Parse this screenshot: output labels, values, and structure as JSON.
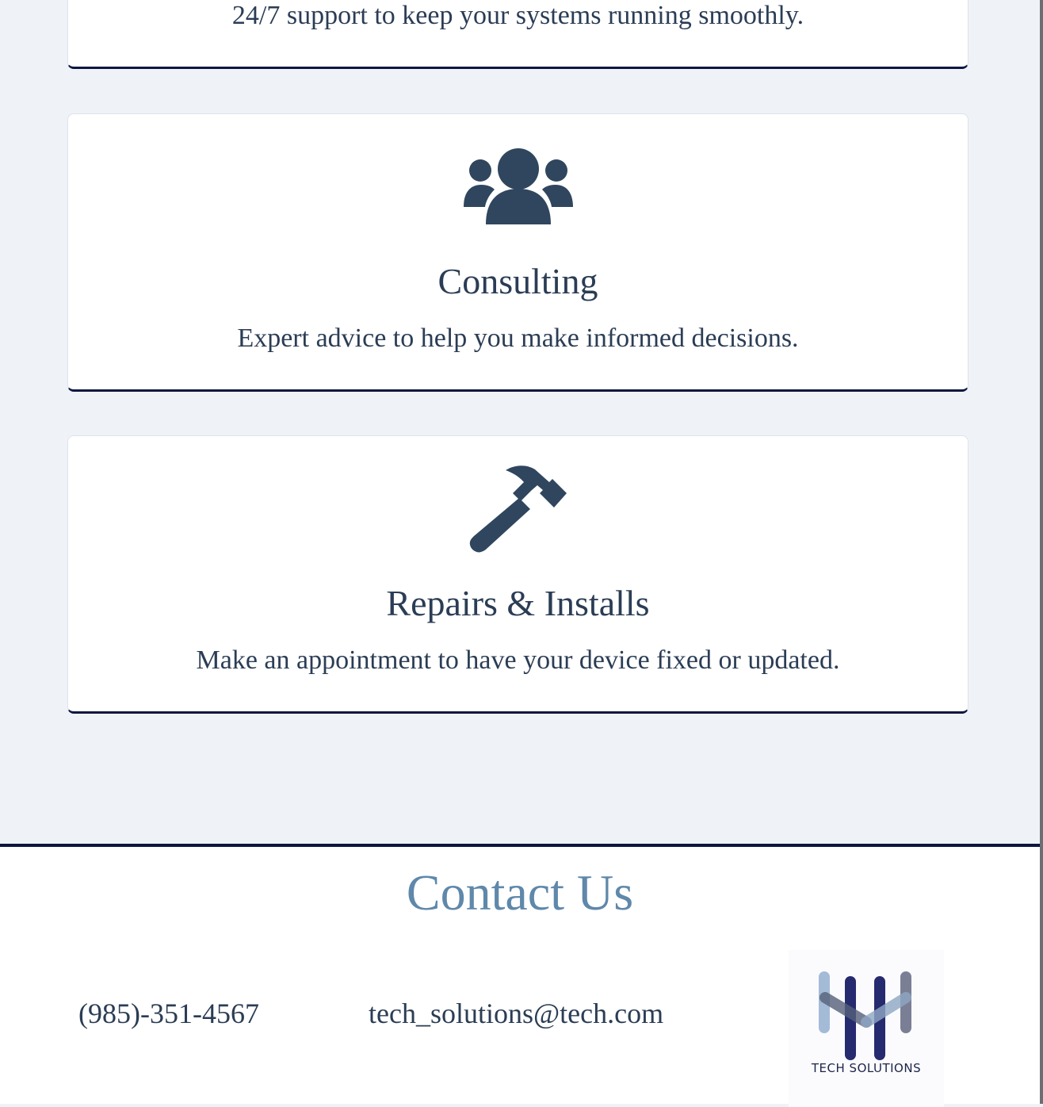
{
  "services": [
    {
      "title": "",
      "description": "24/7 support to keep your systems running smoothly."
    },
    {
      "icon": "users-icon",
      "title": "Consulting",
      "description": "Expert advice to help you make informed decisions."
    },
    {
      "icon": "hammer-icon",
      "title": "Repairs & Installs",
      "description": "Make an appointment to have your device fixed or updated."
    }
  ],
  "contact": {
    "title": "Contact Us",
    "phone": "(985)-351-4567",
    "email": "tech_solutions@tech.com",
    "logo_text": "TECH SOLUTIONS"
  },
  "colors": {
    "background": "#eff3f8",
    "text": "#2b3d55",
    "accent_border": "#0e1740",
    "contact_title": "#5f88aa",
    "icon": "#2f465e"
  }
}
